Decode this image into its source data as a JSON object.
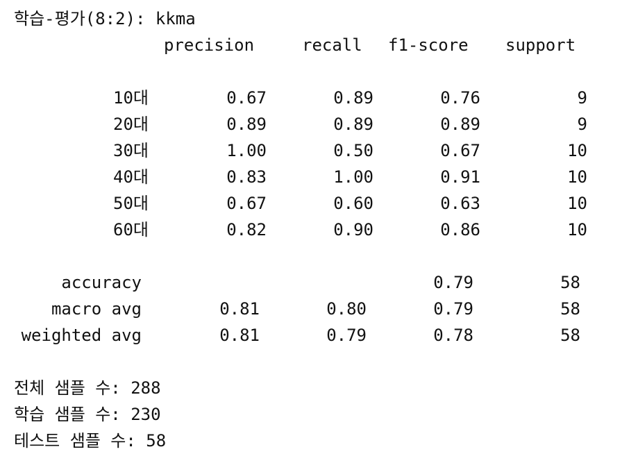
{
  "title": "학습-평가(8:2): kkma",
  "headers": [
    "precision",
    "recall",
    "f1-score",
    "support"
  ],
  "class_rows": [
    {
      "label": "10대",
      "precision": "0.67",
      "recall": "0.89",
      "f1": "0.76",
      "support": "9"
    },
    {
      "label": "20대",
      "precision": "0.89",
      "recall": "0.89",
      "f1": "0.89",
      "support": "9"
    },
    {
      "label": "30대",
      "precision": "1.00",
      "recall": "0.50",
      "f1": "0.67",
      "support": "10"
    },
    {
      "label": "40대",
      "precision": "0.83",
      "recall": "1.00",
      "f1": "0.91",
      "support": "10"
    },
    {
      "label": "50대",
      "precision": "0.67",
      "recall": "0.60",
      "f1": "0.63",
      "support": "10"
    },
    {
      "label": "60대",
      "precision": "0.82",
      "recall": "0.90",
      "f1": "0.86",
      "support": "10"
    }
  ],
  "summary_rows": [
    {
      "label": "accuracy",
      "precision": "",
      "recall": "",
      "f1": "0.79",
      "support": "58"
    },
    {
      "label": "macro avg",
      "precision": "0.81",
      "recall": "0.80",
      "f1": "0.79",
      "support": "58"
    },
    {
      "label": "weighted avg",
      "precision": "0.81",
      "recall": "0.79",
      "f1": "0.78",
      "support": "58"
    }
  ],
  "totals": [
    "전체 샘플 수: 288",
    "학습 샘플 수: 230",
    "테스트 샘플 수: 58"
  ]
}
